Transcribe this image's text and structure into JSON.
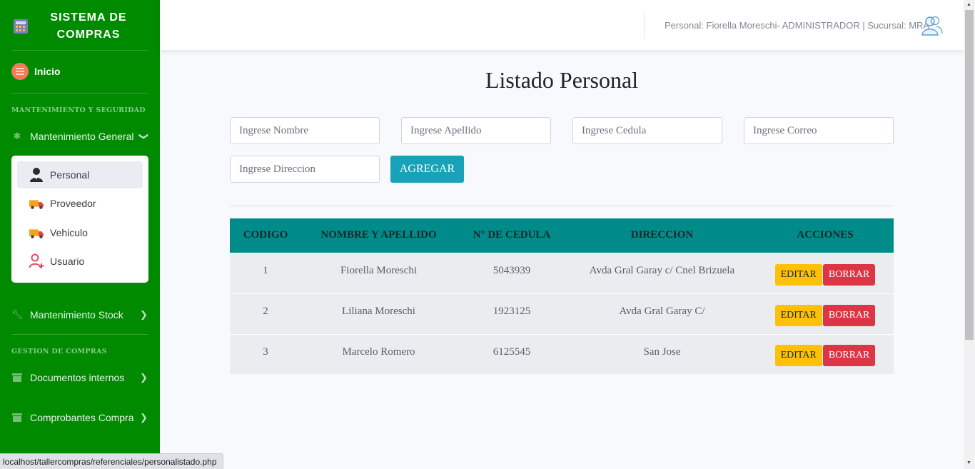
{
  "sidebar": {
    "brand_line1": "SISTEMA DE",
    "brand_line2": "COMPRAS",
    "inicio": "Inicio",
    "heading_mantenimiento": "MANTENIMIENTO Y SEGURIDAD",
    "mantenimiento_general": "Mantenimiento General",
    "submenu": [
      {
        "label": "Personal",
        "icon": "person-icon"
      },
      {
        "label": "Proveedor",
        "icon": "truck-icon"
      },
      {
        "label": "Vehiculo",
        "icon": "truck-icon"
      },
      {
        "label": "Usuario",
        "icon": "user-add-icon"
      }
    ],
    "mantenimiento_stock": "Mantenimiento Stock",
    "heading_gestion": "GESTION DE COMPRAS",
    "documentos_internos": "Documentos internos",
    "comprobantes_compra": "Comprobantes Compra",
    "accent": "#008a00"
  },
  "topbar": {
    "user_text": "Personal: Fiorella Moreschi- ADMINISTRADOR | Sucursal: MRA"
  },
  "main": {
    "title": "Listado Personal",
    "form": {
      "nombre_placeholder": "Ingrese Nombre",
      "apellido_placeholder": "Ingrese Apellido",
      "cedula_placeholder": "Ingrese Cedula",
      "correo_placeholder": "Ingrese Correo",
      "direccion_placeholder": "Ingrese Direccion",
      "add_label": "AGREGAR"
    },
    "table": {
      "headers": [
        "CODIGO",
        "NOMBRE Y APELLIDO",
        "N° DE CEDULA",
        "DIRECCION",
        "ACCIONES"
      ],
      "edit_label": "EDITAR",
      "delete_label": "BORRAR",
      "rows": [
        {
          "codigo": "1",
          "nombre": "Fiorella Moreschi",
          "cedula": "5043939",
          "direccion": "Avda Gral Garay c/ Cnel Brizuela"
        },
        {
          "codigo": "2",
          "nombre": "Liliana Moreschi",
          "cedula": "1923125",
          "direccion": "Avda Gral Garay C/"
        },
        {
          "codigo": "3",
          "nombre": "Marcelo Romero",
          "cedula": "6125545",
          "direccion": "San Jose"
        }
      ]
    }
  },
  "statusbar": {
    "url": "localhost/tallercompras/referenciales/personalistado.php"
  }
}
